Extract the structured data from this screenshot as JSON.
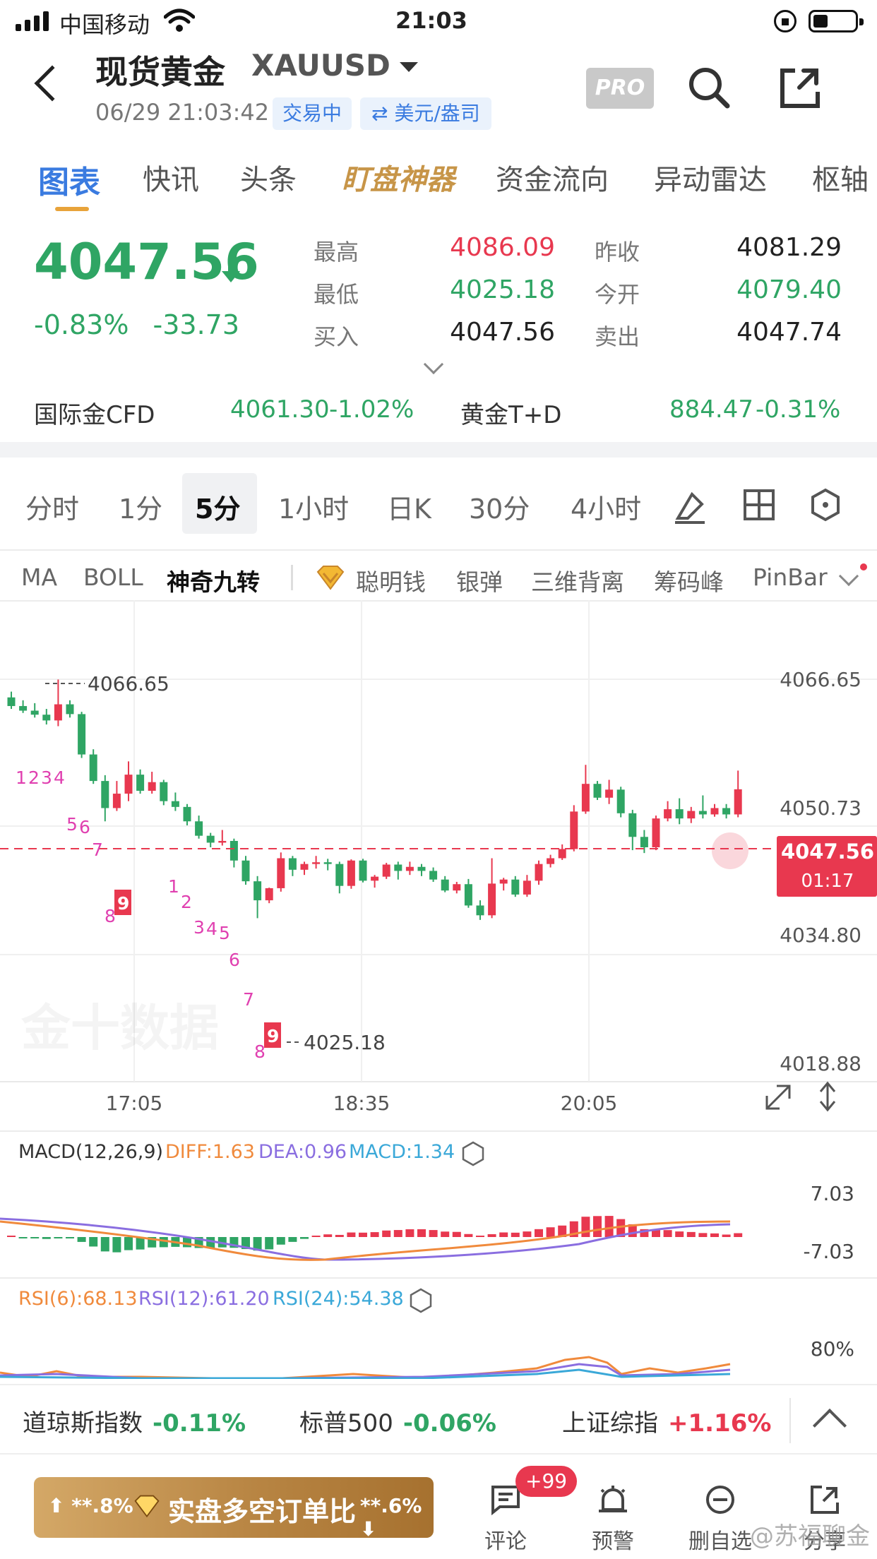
{
  "status_bar": {
    "carrier": "中国移动",
    "time": "21:03"
  },
  "header": {
    "title": "现货黄金",
    "symbol": "XAUUSD",
    "datetime": "06/29 21:03:42",
    "trading_status": "交易中",
    "unit": "⇄ 美元/盎司",
    "pro": "PRO"
  },
  "tabs": [
    "图表",
    "快讯",
    "头条",
    "盯盘神器",
    "资金流向",
    "异动雷达",
    "枢轴"
  ],
  "quote": {
    "price": "4047.56",
    "change_pct": "-0.83%",
    "change": "-33.73",
    "high_label": "最高",
    "high": "4086.09",
    "low_label": "最低",
    "low": "4025.18",
    "bid_label": "买入",
    "bid": "4047.56",
    "prev_close_label": "昨收",
    "prev_close": "4081.29",
    "open_label": "今开",
    "open": "4079.40",
    "ask_label": "卖出",
    "ask": "4047.74"
  },
  "related": {
    "cfd_label": "国际金CFD",
    "cfd_value": "4061.30",
    "cfd_change": "-1.02%",
    "td_label": "黄金T+D",
    "td_value": "884.47",
    "td_change": "-0.31%"
  },
  "periods": [
    "分时",
    "1分",
    "5分",
    "1小时",
    "日K",
    "30分",
    "4小时"
  ],
  "indicators": [
    "MA",
    "BOLL",
    "神奇九转",
    "聪明钱",
    "银弹",
    "三维背离",
    "筹码峰",
    "PinBar"
  ],
  "chart_data": {
    "type": "candlestick",
    "y_ticks": [
      "4066.65",
      "4050.73",
      "4034.80",
      "4018.88"
    ],
    "x_ticks": [
      "17:05",
      "18:35",
      "20:05"
    ],
    "high_marker": "4066.65",
    "low_marker": "4025.18",
    "last_price": "4047.56",
    "countdown": "01:17",
    "watermark": "金十数据",
    "nine_turn_up": [
      "1",
      "2",
      "3",
      "4",
      "5",
      "6",
      "7",
      "8",
      "9"
    ],
    "nine_turn_down": [
      "1",
      "2",
      "3",
      "4",
      "5",
      "6",
      "7",
      "8",
      "9"
    ],
    "candles": [
      [
        4063.5,
        4064.5,
        4061.5,
        4062.0
      ],
      [
        4062.0,
        4063.0,
        4060.8,
        4061.2
      ],
      [
        4061.2,
        4062.5,
        4060.0,
        4060.5
      ],
      [
        4060.5,
        4061.5,
        4058.8,
        4059.5
      ],
      [
        4059.5,
        4066.6,
        4058.5,
        4062.3
      ],
      [
        4062.3,
        4063.0,
        4060.0,
        4060.6
      ],
      [
        4060.6,
        4061.0,
        4053.0,
        4053.6
      ],
      [
        4053.6,
        4054.5,
        4048.5,
        4049.0
      ],
      [
        4049.0,
        4050.0,
        4042.0,
        4044.3
      ],
      [
        4044.3,
        4049.0,
        4043.8,
        4046.8
      ],
      [
        4046.8,
        4052.4,
        4045.5,
        4050.1
      ],
      [
        4050.1,
        4051.0,
        4046.8,
        4047.3
      ],
      [
        4047.3,
        4050.6,
        4046.8,
        4048.8
      ],
      [
        4048.8,
        4049.2,
        4044.8,
        4045.5
      ],
      [
        4045.5,
        4047.0,
        4043.8,
        4044.5
      ],
      [
        4044.5,
        4045.0,
        4041.3,
        4042.0
      ],
      [
        4042.0,
        4043.0,
        4039.0,
        4039.5
      ],
      [
        4039.5,
        4040.0,
        4037.5,
        4038.3
      ],
      [
        4038.3,
        4040.5,
        4037.8,
        4038.6
      ],
      [
        4038.6,
        4039.0,
        4034.0,
        4035.2
      ],
      [
        4035.2,
        4036.0,
        4031.0,
        4031.6
      ],
      [
        4031.6,
        4032.5,
        4025.2,
        4028.3
      ],
      [
        4028.3,
        4030.5,
        4027.8,
        4030.4
      ],
      [
        4030.4,
        4036.6,
        4029.8,
        4035.6
      ],
      [
        4035.6,
        4036.0,
        4032.5,
        4033.6
      ],
      [
        4033.6,
        4035.0,
        4032.7,
        4034.6
      ],
      [
        4034.6,
        4036.0,
        4033.8,
        4034.9
      ],
      [
        4034.9,
        4035.5,
        4033.5,
        4034.6
      ],
      [
        4034.6,
        4035.0,
        4029.5,
        4030.8
      ],
      [
        4030.8,
        4035.4,
        4030.3,
        4035.2
      ],
      [
        4035.2,
        4035.5,
        4031.4,
        4031.7
      ],
      [
        4031.7,
        4032.7,
        4030.5,
        4032.4
      ],
      [
        4032.4,
        4034.8,
        4032.0,
        4034.5
      ],
      [
        4034.5,
        4035.0,
        4031.9,
        4033.4
      ],
      [
        4033.4,
        4035.0,
        4032.7,
        4034.1
      ],
      [
        4034.1,
        4034.6,
        4032.5,
        4033.4
      ],
      [
        4033.4,
        4034.0,
        4031.5,
        4031.9
      ],
      [
        4031.9,
        4032.5,
        4029.7,
        4030.0
      ],
      [
        4030.0,
        4031.5,
        4029.5,
        4031.1
      ],
      [
        4031.1,
        4032.0,
        4027.0,
        4027.4
      ],
      [
        4027.4,
        4028.3,
        4024.9,
        4025.7
      ],
      [
        4025.7,
        4035.6,
        4025.2,
        4031.2
      ],
      [
        4031.2,
        4032.2,
        4030.0,
        4031.9
      ],
      [
        4031.9,
        4032.5,
        4028.9,
        4029.3
      ],
      [
        4029.3,
        4032.7,
        4028.9,
        4031.7
      ],
      [
        4031.7,
        4035.2,
        4031.0,
        4034.6
      ],
      [
        4034.6,
        4036.2,
        4034.0,
        4035.6
      ],
      [
        4035.6,
        4038.0,
        4035.3,
        4037.2
      ],
      [
        4037.2,
        4044.8,
        4036.8,
        4043.7
      ],
      [
        4043.7,
        4051.8,
        4043.3,
        4048.5
      ],
      [
        4048.5,
        4049.0,
        4045.7,
        4046.1
      ],
      [
        4046.1,
        4049.2,
        4045.0,
        4047.5
      ],
      [
        4047.5,
        4048.0,
        4042.7,
        4043.4
      ],
      [
        4043.4,
        4044.0,
        4037.0,
        4039.3
      ],
      [
        4039.3,
        4040.5,
        4036.5,
        4037.5
      ],
      [
        4037.5,
        4043.0,
        4037.0,
        4042.5
      ],
      [
        4042.5,
        4045.5,
        4042.0,
        4044.1
      ],
      [
        4044.1,
        4046.0,
        4041.5,
        4042.5
      ],
      [
        4042.5,
        4044.5,
        4041.7,
        4043.8
      ],
      [
        4043.8,
        4046.5,
        4042.5,
        4043.2
      ],
      [
        4043.2,
        4045.0,
        4042.8,
        4044.3
      ],
      [
        4044.3,
        4045.0,
        4042.5,
        4043.2
      ],
      [
        4043.2,
        4050.8,
        4042.7,
        4047.56
      ]
    ]
  },
  "macd": {
    "label": "MACD(12,26,9)",
    "diff": "DIFF:1.63",
    "dea": "DEA:0.96",
    "macd": "MACD:1.34",
    "y_top": "7.03",
    "y_bottom": "-7.03"
  },
  "rsi": {
    "rsi6": "RSI(6):68.13",
    "rsi12": "RSI(12):61.20",
    "rsi24": "RSI(24):54.38",
    "y_top": "80%"
  },
  "indices": [
    {
      "name": "道琼斯指数",
      "change": "-0.11%"
    },
    {
      "name": "标普500",
      "change": "-0.06%"
    },
    {
      "name": "上证综指",
      "change": "+1.16%"
    }
  ],
  "promo": {
    "left": "⬆ **.8%",
    "title": "实盘多空订单比",
    "right": "**.6% ⬇"
  },
  "nav": {
    "comment": "评论",
    "comment_badge": "+99",
    "alert": "预警",
    "delete": "删自选",
    "share": "分享",
    "watermark": "@苏福聊金"
  },
  "colors": {
    "up": "#e8384f",
    "down": "#2fa564",
    "accent": "#3a7be0",
    "gold": "#c79548"
  }
}
